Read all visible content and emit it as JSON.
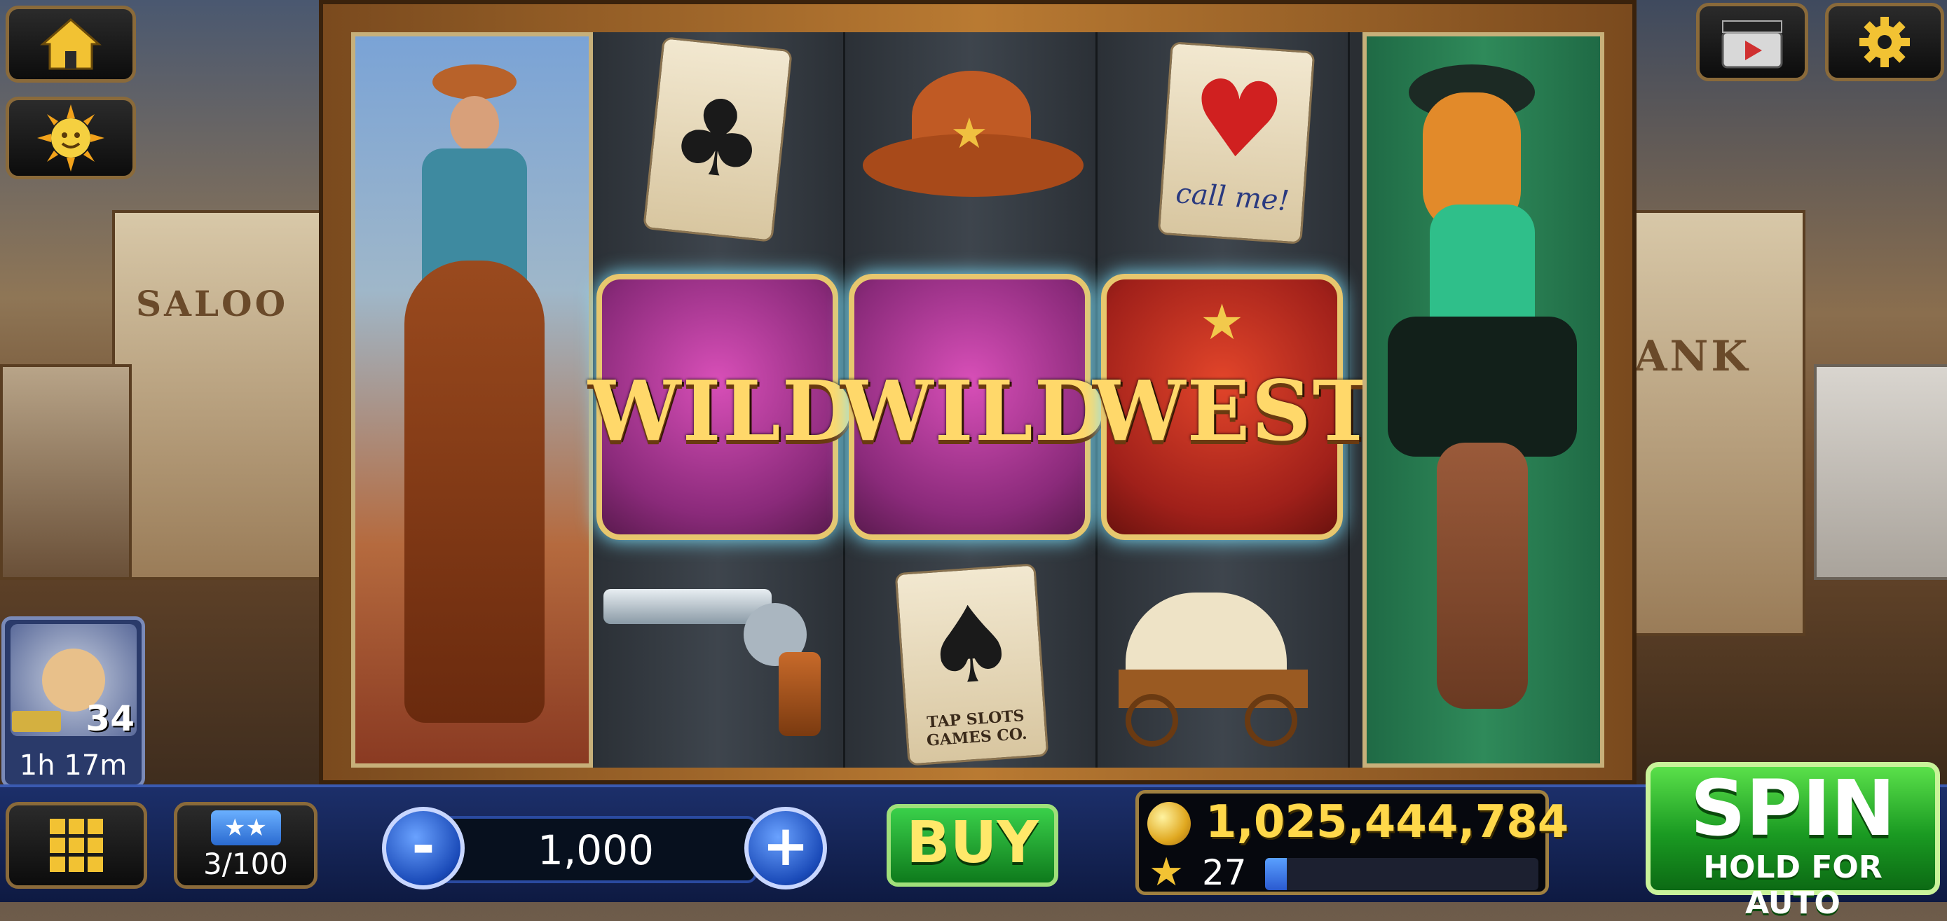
{
  "background": {
    "left_sign": "SALOO",
    "right_sign": "ANK"
  },
  "reels": {
    "top_row": [
      "clubs-card-icon",
      "sheriff-hat-icon",
      "hearts-card-icon"
    ],
    "middle_row": [
      {
        "word": "WILD",
        "color": "#b03a98"
      },
      {
        "word": "WILD",
        "color": "#b03a98"
      },
      {
        "word": "WEST",
        "color": "#c0281c"
      }
    ],
    "bottom_row": [
      "revolver-icon",
      "spades-card-icon",
      "wagon-icon"
    ],
    "heart_card_text": "call me!",
    "spade_card_text": "TAP SLOTS GAMES CO."
  },
  "player": {
    "level": "34",
    "timer": "1h 17m"
  },
  "bottom": {
    "collection": "3/100",
    "minus": "-",
    "plus": "+",
    "bet": "1,000",
    "buy": "BUY",
    "coins": "1,025,444,784",
    "stars": "27",
    "star_progress": 0.08,
    "spin": "SPIN",
    "spin_sub": "HOLD FOR AUTO"
  }
}
